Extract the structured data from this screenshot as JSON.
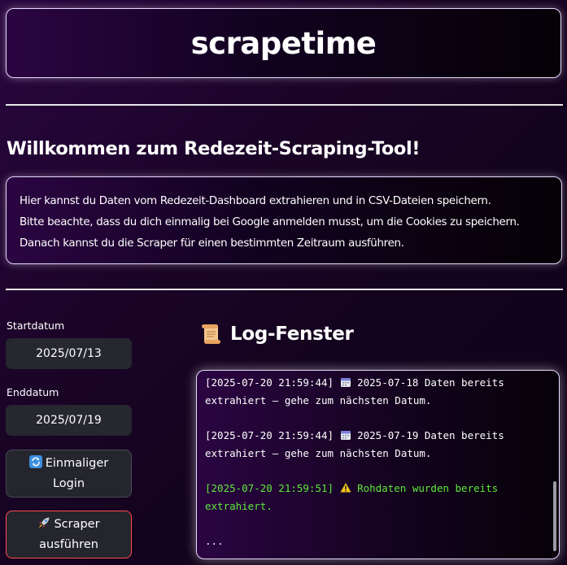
{
  "app": {
    "title": "scrapetime"
  },
  "welcome": {
    "heading": "Willkommen zum Redezeit-Scraping-Tool!",
    "lines": [
      "Hier kannst du Daten vom Redezeit-Dashboard extrahieren und in CSV-Dateien speichern.",
      "Bitte beachte, dass du dich einmalig bei Google anmelden musst, um die Cookies zu speichern.",
      "Danach kannst du die Scraper für einen bestimmten Zeitraum ausführen."
    ]
  },
  "sidebar": {
    "start_label": "Startdatum",
    "start_value": "2025/07/13",
    "end_label": "Enddatum",
    "end_value": "2025/07/19",
    "login_button": {
      "icon": "refresh-icon",
      "line1": "Einmaliger",
      "line2": "Login"
    },
    "scraper_button": {
      "icon": "rocket-icon",
      "line1": "Scraper",
      "line2": "ausführen"
    }
  },
  "log": {
    "icon": "scroll-icon",
    "title": "Log-Fenster",
    "entries": [
      {
        "timestamp": "[2025-07-20 21:59:44]",
        "icon": "calendar-icon",
        "line1": "2025-07-18 Daten bereits",
        "line2": "extrahiert – gehe zum nächsten Datum."
      },
      {
        "timestamp": "[2025-07-20 21:59:44]",
        "icon": "calendar-icon",
        "line1": "2025-07-19 Daten bereits",
        "line2": "extrahiert – gehe zum nächsten Datum."
      },
      {
        "timestamp": "[2025-07-20 21:59:51]",
        "icon": "warning-icon",
        "line1": "Rohdaten wurden bereits",
        "line2": "extrahiert."
      }
    ],
    "ellipsis": "..."
  },
  "colors": {
    "accent_border": "#ff4b4b",
    "success_text": "#5dea38",
    "panel_border": "#e8d8ff",
    "input_bg": "#26272f"
  }
}
